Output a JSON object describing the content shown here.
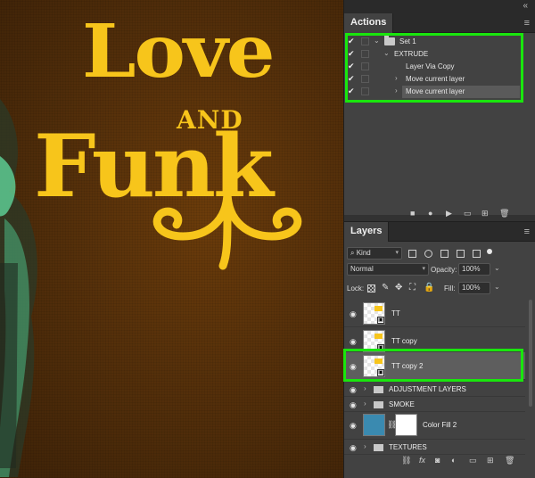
{
  "actions_panel": {
    "tab": "Actions",
    "rows": [
      {
        "label": "Set 1",
        "checked": true
      },
      {
        "label": "EXTRUDE",
        "checked": true
      },
      {
        "label": "Layer Via Copy",
        "checked": true
      },
      {
        "label": "Move current layer",
        "checked": true
      },
      {
        "label": "Move current layer",
        "checked": true,
        "selected": true
      }
    ],
    "toolbar_icons": [
      "stop-icon",
      "record-icon",
      "play-icon",
      "new-set-icon",
      "new-action-icon",
      "delete-icon"
    ]
  },
  "layers_panel": {
    "tab": "Layers",
    "filter_kind": "Kind",
    "blend_mode": "Normal",
    "opacity_label": "Opacity:",
    "opacity_value": "100%",
    "lock_label": "Lock:",
    "fill_label": "Fill:",
    "fill_value": "100%",
    "layers": [
      {
        "name": "TT",
        "type": "smart-object"
      },
      {
        "name": "TT copy",
        "type": "smart-object"
      },
      {
        "name": "TT copy 2",
        "type": "smart-object",
        "selected": true
      },
      {
        "name": "ADJUSTMENT LAYERS",
        "type": "group"
      },
      {
        "name": "SMOKE",
        "type": "group"
      },
      {
        "name": "Color Fill 2",
        "type": "fill"
      },
      {
        "name": "TEXTURES",
        "type": "group"
      }
    ],
    "footer_fx": "fx"
  },
  "canvas": {
    "word1": "Love",
    "word2": "AND",
    "word3": "Funk"
  },
  "colors": {
    "highlight": "#19e60d",
    "logo_yellow": "#f7c51b",
    "background_brown": "#5a330a",
    "fill_swatch": "#3a8ab0"
  }
}
